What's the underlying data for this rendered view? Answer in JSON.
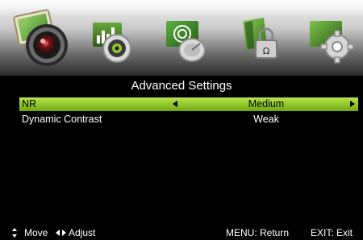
{
  "menu_tabs": [
    {
      "icon": "picture-icon",
      "active": true
    },
    {
      "icon": "sound-icon",
      "active": false
    },
    {
      "icon": "channel-icon",
      "active": false
    },
    {
      "icon": "lock-icon",
      "active": false
    },
    {
      "icon": "setup-icon",
      "active": false
    }
  ],
  "title": "Advanced Settings",
  "settings": [
    {
      "label": "NR",
      "value": "Medium",
      "selected": true
    },
    {
      "label": "Dynamic Contrast",
      "value": "Weak",
      "selected": false
    }
  ],
  "footer": {
    "move": "Move",
    "adjust": "Adjust",
    "menu_return": "MENU: Return",
    "exit": "EXIT: Exit"
  },
  "colors": {
    "highlight": "#8fc52a",
    "background": "#000000",
    "text": "#ffffff"
  }
}
